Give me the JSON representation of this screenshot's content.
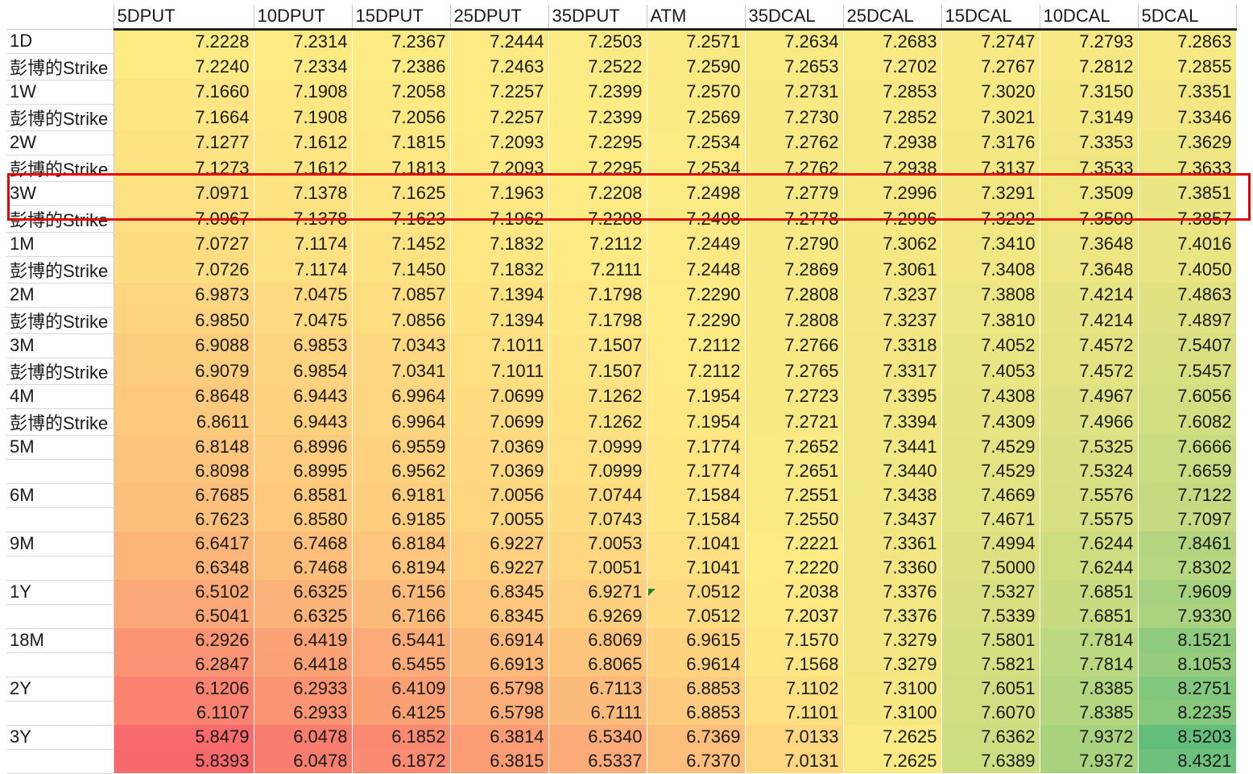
{
  "columns": [
    "5DPUT",
    "10DPUT",
    "15DPUT",
    "25DPUT",
    "35DPUT",
    "ATM",
    "35DCAL",
    "25DCAL",
    "15DCAL",
    "10DCAL",
    "5DCAL"
  ],
  "rows": [
    {
      "label": "1D",
      "values": [
        "7.2228",
        "7.2314",
        "7.2367",
        "7.2444",
        "7.2503",
        "7.2571",
        "7.2634",
        "7.2683",
        "7.2747",
        "7.2793",
        "7.2863"
      ]
    },
    {
      "label": "彭博的Strike",
      "values": [
        "7.2240",
        "7.2334",
        "7.2386",
        "7.2463",
        "7.2522",
        "7.2590",
        "7.2653",
        "7.2702",
        "7.2767",
        "7.2812",
        "7.2855"
      ]
    },
    {
      "label": "1W",
      "values": [
        "7.1660",
        "7.1908",
        "7.2058",
        "7.2257",
        "7.2399",
        "7.2570",
        "7.2731",
        "7.2853",
        "7.3020",
        "7.3150",
        "7.3351"
      ]
    },
    {
      "label": "彭博的Strike",
      "values": [
        "7.1664",
        "7.1908",
        "7.2056",
        "7.2257",
        "7.2399",
        "7.2569",
        "7.2730",
        "7.2852",
        "7.3021",
        "7.3149",
        "7.3346"
      ]
    },
    {
      "label": "2W",
      "values": [
        "7.1277",
        "7.1612",
        "7.1815",
        "7.2093",
        "7.2295",
        "7.2534",
        "7.2762",
        "7.2938",
        "7.3176",
        "7.3353",
        "7.3629"
      ]
    },
    {
      "label": "彭博的Strike",
      "values": [
        "7.1273",
        "7.1612",
        "7.1813",
        "7.2093",
        "7.2295",
        "7.2534",
        "7.2762",
        "7.2938",
        "7.3137",
        "7.3533",
        "7.3633"
      ]
    },
    {
      "label": "3W",
      "values": [
        "7.0971",
        "7.1378",
        "7.1625",
        "7.1963",
        "7.2208",
        "7.2498",
        "7.2779",
        "7.2996",
        "7.3291",
        "7.3509",
        "7.3851"
      ]
    },
    {
      "label": "彭博的Strike",
      "values": [
        "7.0967",
        "7.1378",
        "7.1623",
        "7.1962",
        "7.2208",
        "7.2498",
        "7.2778",
        "7.2996",
        "7.3292",
        "7.3509",
        "7.3857"
      ]
    },
    {
      "label": "1M",
      "values": [
        "7.0727",
        "7.1174",
        "7.1452",
        "7.1832",
        "7.2112",
        "7.2449",
        "7.2790",
        "7.3062",
        "7.3410",
        "7.3648",
        "7.4016"
      ]
    },
    {
      "label": "彭博的Strike",
      "values": [
        "7.0726",
        "7.1174",
        "7.1450",
        "7.1832",
        "7.2111",
        "7.2448",
        "7.2869",
        "7.3061",
        "7.3408",
        "7.3648",
        "7.4050"
      ]
    },
    {
      "label": "2M",
      "values": [
        "6.9873",
        "7.0475",
        "7.0857",
        "7.1394",
        "7.1798",
        "7.2290",
        "7.2808",
        "7.3237",
        "7.3808",
        "7.4214",
        "7.4863"
      ]
    },
    {
      "label": "彭博的Strike",
      "values": [
        "6.9850",
        "7.0475",
        "7.0856",
        "7.1394",
        "7.1798",
        "7.2290",
        "7.2808",
        "7.3237",
        "7.3810",
        "7.4214",
        "7.4897"
      ]
    },
    {
      "label": "3M",
      "values": [
        "6.9088",
        "6.9853",
        "7.0343",
        "7.1011",
        "7.1507",
        "7.2112",
        "7.2766",
        "7.3318",
        "7.4052",
        "7.4572",
        "7.5407"
      ]
    },
    {
      "label": "彭博的Strike",
      "values": [
        "6.9079",
        "6.9854",
        "7.0341",
        "7.1011",
        "7.1507",
        "7.2112",
        "7.2765",
        "7.3317",
        "7.4053",
        "7.4572",
        "7.5457"
      ]
    },
    {
      "label": "4M",
      "values": [
        "6.8648",
        "6.9443",
        "6.9964",
        "7.0699",
        "7.1262",
        "7.1954",
        "7.2723",
        "7.3395",
        "7.4308",
        "7.4967",
        "7.6056"
      ]
    },
    {
      "label": "彭博的Strike",
      "values": [
        "6.8611",
        "6.9443",
        "6.9964",
        "7.0699",
        "7.1262",
        "7.1954",
        "7.2721",
        "7.3394",
        "7.4309",
        "7.4966",
        "7.6082"
      ]
    },
    {
      "label": "5M",
      "values": [
        "6.8148",
        "6.8996",
        "6.9559",
        "7.0369",
        "7.0999",
        "7.1774",
        "7.2652",
        "7.3441",
        "7.4529",
        "7.5325",
        "7.6666"
      ]
    },
    {
      "label": "",
      "values": [
        "6.8098",
        "6.8995",
        "6.9562",
        "7.0369",
        "7.0999",
        "7.1774",
        "7.2651",
        "7.3440",
        "7.4529",
        "7.5324",
        "7.6659"
      ]
    },
    {
      "label": "6M",
      "values": [
        "6.7685",
        "6.8581",
        "6.9181",
        "7.0056",
        "7.0744",
        "7.1584",
        "7.2551",
        "7.3438",
        "7.4669",
        "7.5576",
        "7.7122"
      ]
    },
    {
      "label": "",
      "values": [
        "6.7623",
        "6.8580",
        "6.9185",
        "7.0055",
        "7.0743",
        "7.1584",
        "7.2550",
        "7.3437",
        "7.4671",
        "7.5575",
        "7.7097"
      ]
    },
    {
      "label": "9M",
      "values": [
        "6.6417",
        "6.7468",
        "6.8184",
        "6.9227",
        "7.0053",
        "7.1041",
        "7.2221",
        "7.3361",
        "7.4994",
        "7.6244",
        "7.8461"
      ]
    },
    {
      "label": "",
      "values": [
        "6.6348",
        "6.7468",
        "6.8194",
        "6.9227",
        "7.0051",
        "7.1041",
        "7.2220",
        "7.3360",
        "7.5000",
        "7.6244",
        "7.8302"
      ]
    },
    {
      "label": "1Y",
      "values": [
        "6.5102",
        "6.6325",
        "6.7156",
        "6.8345",
        "6.9271",
        "7.0512",
        "7.2038",
        "7.3376",
        "7.5327",
        "7.6851",
        "7.9609"
      ]
    },
    {
      "label": "",
      "values": [
        "6.5041",
        "6.6325",
        "6.7166",
        "6.8345",
        "6.9269",
        "7.0512",
        "7.2037",
        "7.3376",
        "7.5339",
        "7.6851",
        "7.9330"
      ]
    },
    {
      "label": "18M",
      "values": [
        "6.2926",
        "6.4419",
        "6.5441",
        "6.6914",
        "6.8069",
        "6.9615",
        "7.1570",
        "7.3279",
        "7.5801",
        "7.7814",
        "8.1521"
      ]
    },
    {
      "label": "",
      "values": [
        "6.2847",
        "6.4418",
        "6.5455",
        "6.6913",
        "6.8065",
        "6.9614",
        "7.1568",
        "7.3279",
        "7.5821",
        "7.7814",
        "8.1053"
      ]
    },
    {
      "label": "2Y",
      "values": [
        "6.1206",
        "6.2933",
        "6.4109",
        "6.5798",
        "6.7113",
        "6.8853",
        "7.1102",
        "7.3100",
        "7.6051",
        "7.8385",
        "8.2751"
      ]
    },
    {
      "label": "",
      "values": [
        "6.1107",
        "6.2933",
        "6.4125",
        "6.5798",
        "6.7111",
        "6.8853",
        "7.1101",
        "7.3100",
        "7.6070",
        "7.8385",
        "8.2235"
      ]
    },
    {
      "label": "3Y",
      "values": [
        "5.8479",
        "6.0478",
        "6.1852",
        "6.3814",
        "6.5340",
        "6.7369",
        "7.0133",
        "7.2625",
        "7.6362",
        "7.9372",
        "8.5203"
      ]
    },
    {
      "label": "",
      "values": [
        "5.8393",
        "6.0478",
        "6.1872",
        "6.3815",
        "6.5337",
        "6.7370",
        "7.0131",
        "7.2625",
        "7.6389",
        "7.9372",
        "8.4321"
      ]
    }
  ],
  "color_scale": {
    "low": "#f8696b",
    "mid": "#ffeb84",
    "high": "#63be7b"
  },
  "highlighted_rows": [
    6,
    7
  ]
}
